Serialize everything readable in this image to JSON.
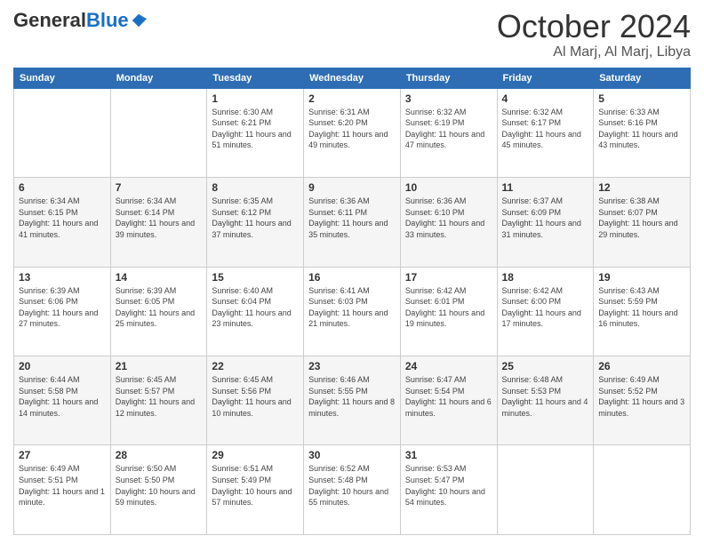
{
  "header": {
    "logo": {
      "general": "General",
      "blue": "Blue"
    },
    "title": "October 2024",
    "location": "Al Marj, Al Marj, Libya"
  },
  "days_of_week": [
    "Sunday",
    "Monday",
    "Tuesday",
    "Wednesday",
    "Thursday",
    "Friday",
    "Saturday"
  ],
  "weeks": [
    [
      {
        "day": "",
        "info": ""
      },
      {
        "day": "",
        "info": ""
      },
      {
        "day": "1",
        "info": "Sunrise: 6:30 AM\nSunset: 6:21 PM\nDaylight: 11 hours and 51 minutes."
      },
      {
        "day": "2",
        "info": "Sunrise: 6:31 AM\nSunset: 6:20 PM\nDaylight: 11 hours and 49 minutes."
      },
      {
        "day": "3",
        "info": "Sunrise: 6:32 AM\nSunset: 6:19 PM\nDaylight: 11 hours and 47 minutes."
      },
      {
        "day": "4",
        "info": "Sunrise: 6:32 AM\nSunset: 6:17 PM\nDaylight: 11 hours and 45 minutes."
      },
      {
        "day": "5",
        "info": "Sunrise: 6:33 AM\nSunset: 6:16 PM\nDaylight: 11 hours and 43 minutes."
      }
    ],
    [
      {
        "day": "6",
        "info": "Sunrise: 6:34 AM\nSunset: 6:15 PM\nDaylight: 11 hours and 41 minutes."
      },
      {
        "day": "7",
        "info": "Sunrise: 6:34 AM\nSunset: 6:14 PM\nDaylight: 11 hours and 39 minutes."
      },
      {
        "day": "8",
        "info": "Sunrise: 6:35 AM\nSunset: 6:12 PM\nDaylight: 11 hours and 37 minutes."
      },
      {
        "day": "9",
        "info": "Sunrise: 6:36 AM\nSunset: 6:11 PM\nDaylight: 11 hours and 35 minutes."
      },
      {
        "day": "10",
        "info": "Sunrise: 6:36 AM\nSunset: 6:10 PM\nDaylight: 11 hours and 33 minutes."
      },
      {
        "day": "11",
        "info": "Sunrise: 6:37 AM\nSunset: 6:09 PM\nDaylight: 11 hours and 31 minutes."
      },
      {
        "day": "12",
        "info": "Sunrise: 6:38 AM\nSunset: 6:07 PM\nDaylight: 11 hours and 29 minutes."
      }
    ],
    [
      {
        "day": "13",
        "info": "Sunrise: 6:39 AM\nSunset: 6:06 PM\nDaylight: 11 hours and 27 minutes."
      },
      {
        "day": "14",
        "info": "Sunrise: 6:39 AM\nSunset: 6:05 PM\nDaylight: 11 hours and 25 minutes."
      },
      {
        "day": "15",
        "info": "Sunrise: 6:40 AM\nSunset: 6:04 PM\nDaylight: 11 hours and 23 minutes."
      },
      {
        "day": "16",
        "info": "Sunrise: 6:41 AM\nSunset: 6:03 PM\nDaylight: 11 hours and 21 minutes."
      },
      {
        "day": "17",
        "info": "Sunrise: 6:42 AM\nSunset: 6:01 PM\nDaylight: 11 hours and 19 minutes."
      },
      {
        "day": "18",
        "info": "Sunrise: 6:42 AM\nSunset: 6:00 PM\nDaylight: 11 hours and 17 minutes."
      },
      {
        "day": "19",
        "info": "Sunrise: 6:43 AM\nSunset: 5:59 PM\nDaylight: 11 hours and 16 minutes."
      }
    ],
    [
      {
        "day": "20",
        "info": "Sunrise: 6:44 AM\nSunset: 5:58 PM\nDaylight: 11 hours and 14 minutes."
      },
      {
        "day": "21",
        "info": "Sunrise: 6:45 AM\nSunset: 5:57 PM\nDaylight: 11 hours and 12 minutes."
      },
      {
        "day": "22",
        "info": "Sunrise: 6:45 AM\nSunset: 5:56 PM\nDaylight: 11 hours and 10 minutes."
      },
      {
        "day": "23",
        "info": "Sunrise: 6:46 AM\nSunset: 5:55 PM\nDaylight: 11 hours and 8 minutes."
      },
      {
        "day": "24",
        "info": "Sunrise: 6:47 AM\nSunset: 5:54 PM\nDaylight: 11 hours and 6 minutes."
      },
      {
        "day": "25",
        "info": "Sunrise: 6:48 AM\nSunset: 5:53 PM\nDaylight: 11 hours and 4 minutes."
      },
      {
        "day": "26",
        "info": "Sunrise: 6:49 AM\nSunset: 5:52 PM\nDaylight: 11 hours and 3 minutes."
      }
    ],
    [
      {
        "day": "27",
        "info": "Sunrise: 6:49 AM\nSunset: 5:51 PM\nDaylight: 11 hours and 1 minute."
      },
      {
        "day": "28",
        "info": "Sunrise: 6:50 AM\nSunset: 5:50 PM\nDaylight: 10 hours and 59 minutes."
      },
      {
        "day": "29",
        "info": "Sunrise: 6:51 AM\nSunset: 5:49 PM\nDaylight: 10 hours and 57 minutes."
      },
      {
        "day": "30",
        "info": "Sunrise: 6:52 AM\nSunset: 5:48 PM\nDaylight: 10 hours and 55 minutes."
      },
      {
        "day": "31",
        "info": "Sunrise: 6:53 AM\nSunset: 5:47 PM\nDaylight: 10 hours and 54 minutes."
      },
      {
        "day": "",
        "info": ""
      },
      {
        "day": "",
        "info": ""
      }
    ]
  ]
}
